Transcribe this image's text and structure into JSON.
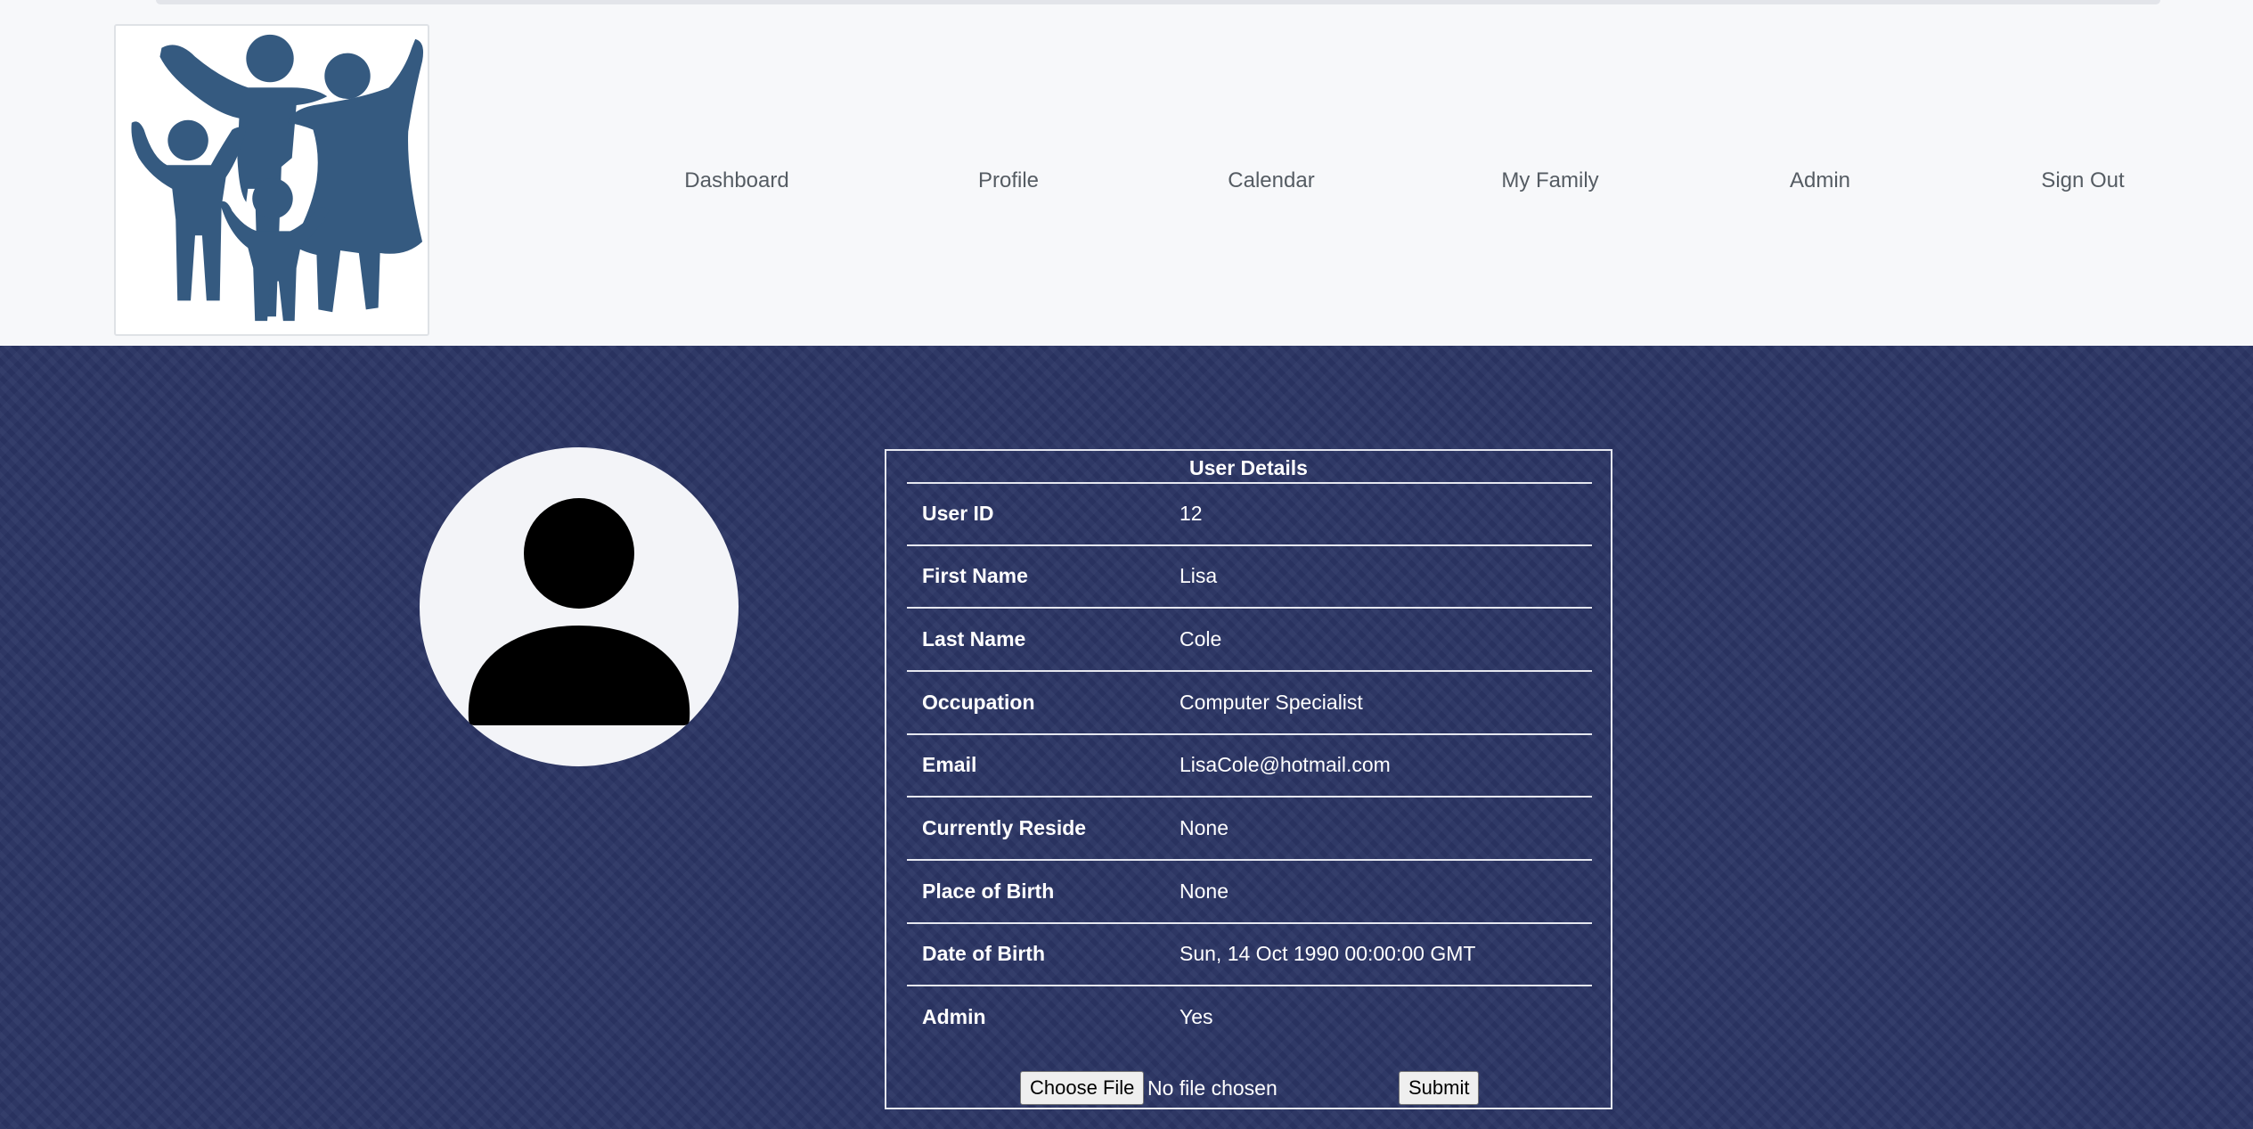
{
  "nav": {
    "logo": "family-logo",
    "links": [
      {
        "label": "Dashboard"
      },
      {
        "label": "Profile"
      },
      {
        "label": "Calendar"
      },
      {
        "label": "My Family"
      },
      {
        "label": "Admin"
      },
      {
        "label": "Sign Out"
      }
    ]
  },
  "avatar": {
    "icon": "user-silhouette-icon"
  },
  "details": {
    "title": "User Details",
    "rows": [
      {
        "label": "User ID",
        "value": "12"
      },
      {
        "label": "First Name",
        "value": "Lisa"
      },
      {
        "label": "Last Name",
        "value": "Cole"
      },
      {
        "label": "Occupation",
        "value": "Computer Specialist"
      },
      {
        "label": "Email",
        "value": "LisaCole@hotmail.com"
      },
      {
        "label": "Currently Reside",
        "value": "None"
      },
      {
        "label": "Place of Birth",
        "value": "None"
      },
      {
        "label": "Date of Birth",
        "value": "Sun, 14 Oct 1990 00:00:00 GMT"
      },
      {
        "label": "Admin",
        "value": "Yes"
      }
    ],
    "upload": {
      "choose_label": "Choose File",
      "status": "No file chosen",
      "submit_label": "Submit"
    }
  },
  "colors": {
    "background": "#2b3564",
    "navbar": "#f7f8fa",
    "logo_blue": "#355a80",
    "text_light": "#ffffff",
    "nav_text": "#555c63"
  }
}
